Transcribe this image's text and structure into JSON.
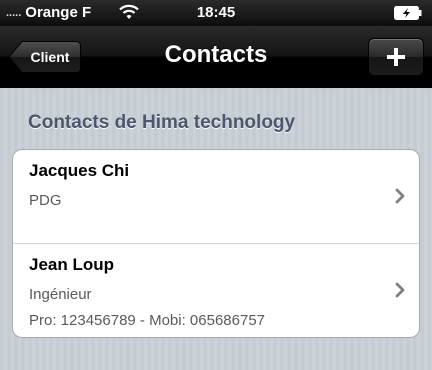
{
  "status_bar": {
    "signal": ".....",
    "carrier": "Orange F",
    "time": "18:45"
  },
  "nav": {
    "back_label": "Client",
    "title": "Contacts",
    "add_label": "+"
  },
  "section": {
    "header": "Contacts de Hima technology"
  },
  "contacts": [
    {
      "name": "Jacques Chi",
      "role": "PDG",
      "phones": ""
    },
    {
      "name": "Jean Loup",
      "role": "Ingénieur",
      "phones": "Pro: 123456789 - Mobi: 065686757"
    }
  ],
  "icons": {
    "wifi": "wifi-icon",
    "battery": "battery-icon",
    "add": "plus-icon",
    "disclosure": "chevron-right-icon"
  },
  "colors": {
    "nav_bg": "#000000",
    "section_header": "#4c566c",
    "background": "#c5ccd4",
    "secondary_text": "#5a5a5a"
  }
}
